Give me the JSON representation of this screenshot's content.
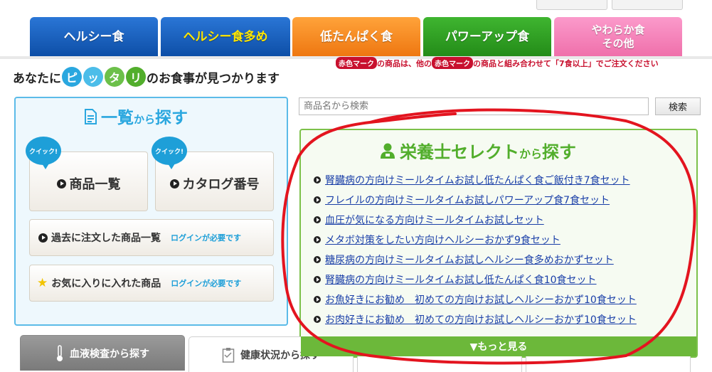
{
  "tabs": [
    {
      "label": "ヘルシー食",
      "color": "#0d56b5"
    },
    {
      "label": "ヘルシー食多め",
      "color": "#0d56b5",
      "highlight": "#ffe600"
    },
    {
      "label": "低たんぱく食",
      "color": "#f07d12"
    },
    {
      "label": "パワーアップ食",
      "color": "#2b9a20"
    },
    {
      "label": "やわらか食",
      "label2": "その他",
      "color": "#f07ab3"
    }
  ],
  "notice": {
    "mark": "赤色マーク",
    "part1": "の商品は、他の",
    "part2": "の商品と組み合わせて「7食以上」でご注文ください"
  },
  "headline": {
    "before": "あなたに",
    "chars": [
      "ピ",
      "ッ",
      "タ",
      "リ"
    ],
    "after": "のお食事が見つかります"
  },
  "left_panel": {
    "title": "一覧",
    "title_suffix": "から",
    "title_end": "探す",
    "quick_label": "クイック!",
    "product_list": "商品一覧",
    "catalog": "カタログ番号",
    "past_orders": "過去に注文した商品一覧",
    "favorites": "お気に入りに入れた商品",
    "login_required": "ログインが必要です"
  },
  "search": {
    "placeholder": "商品名から検索",
    "button": "検索"
  },
  "right_panel": {
    "title": "栄養士セレクト",
    "title_suffix": "から",
    "title_end": "探す",
    "links": [
      "腎臓病の方向けミールタイムお試し低たんぱく食ご飯付き7食セット",
      "フレイルの方向けミールタイムお試しパワーアップ食7食セット",
      "血圧が気になる方向けミールタイムお試しセット",
      "メタボ対策をしたい方向けヘルシーおかず9食セット",
      "糖尿病の方向けミールタイムお試しヘルシー食多めおかずセット",
      "腎臓病の方向けミールタイムお試し低たんぱく食10食セット",
      "お魚好きにお勧め　初めての方向けお試しヘルシーおかず10食セット",
      "お肉好きにお勧め　初めての方向けお試しヘルシーおかず10食セット"
    ],
    "more": "▼もっと見る"
  },
  "bottom_tabs": {
    "blood": "血液検査から探す",
    "health": "健康状況から探す"
  },
  "colors": {
    "accent_blue": "#2aa7df",
    "accent_green": "#52ae2c",
    "notice_red": "#c8102e",
    "link": "#1a3fa8"
  }
}
